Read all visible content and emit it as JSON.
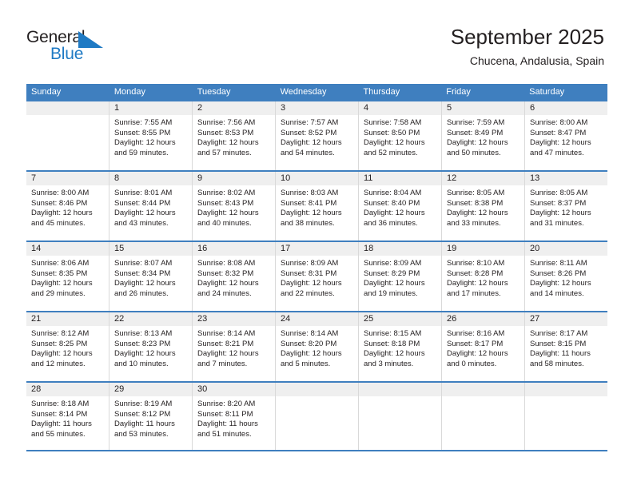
{
  "brand": {
    "name_top": "General",
    "name_bottom": "Blue",
    "triangle_icon": "triangle-icon",
    "color_dark": "#231f20",
    "color_blue": "#1f7ac4"
  },
  "header": {
    "title": "September 2025",
    "subtitle": "Chucena, Andalusia, Spain"
  },
  "calendar": {
    "accent_color": "#3f7fbf",
    "band_color": "#efefef",
    "weekday_headers": [
      "Sunday",
      "Monday",
      "Tuesday",
      "Wednesday",
      "Thursday",
      "Friday",
      "Saturday"
    ],
    "weeks": [
      [
        {
          "day": "",
          "lines": []
        },
        {
          "day": "1",
          "lines": [
            "Sunrise: 7:55 AM",
            "Sunset: 8:55 PM",
            "Daylight: 12 hours",
            "and 59 minutes."
          ]
        },
        {
          "day": "2",
          "lines": [
            "Sunrise: 7:56 AM",
            "Sunset: 8:53 PM",
            "Daylight: 12 hours",
            "and 57 minutes."
          ]
        },
        {
          "day": "3",
          "lines": [
            "Sunrise: 7:57 AM",
            "Sunset: 8:52 PM",
            "Daylight: 12 hours",
            "and 54 minutes."
          ]
        },
        {
          "day": "4",
          "lines": [
            "Sunrise: 7:58 AM",
            "Sunset: 8:50 PM",
            "Daylight: 12 hours",
            "and 52 minutes."
          ]
        },
        {
          "day": "5",
          "lines": [
            "Sunrise: 7:59 AM",
            "Sunset: 8:49 PM",
            "Daylight: 12 hours",
            "and 50 minutes."
          ]
        },
        {
          "day": "6",
          "lines": [
            "Sunrise: 8:00 AM",
            "Sunset: 8:47 PM",
            "Daylight: 12 hours",
            "and 47 minutes."
          ]
        }
      ],
      [
        {
          "day": "7",
          "lines": [
            "Sunrise: 8:00 AM",
            "Sunset: 8:46 PM",
            "Daylight: 12 hours",
            "and 45 minutes."
          ]
        },
        {
          "day": "8",
          "lines": [
            "Sunrise: 8:01 AM",
            "Sunset: 8:44 PM",
            "Daylight: 12 hours",
            "and 43 minutes."
          ]
        },
        {
          "day": "9",
          "lines": [
            "Sunrise: 8:02 AM",
            "Sunset: 8:43 PM",
            "Daylight: 12 hours",
            "and 40 minutes."
          ]
        },
        {
          "day": "10",
          "lines": [
            "Sunrise: 8:03 AM",
            "Sunset: 8:41 PM",
            "Daylight: 12 hours",
            "and 38 minutes."
          ]
        },
        {
          "day": "11",
          "lines": [
            "Sunrise: 8:04 AM",
            "Sunset: 8:40 PM",
            "Daylight: 12 hours",
            "and 36 minutes."
          ]
        },
        {
          "day": "12",
          "lines": [
            "Sunrise: 8:05 AM",
            "Sunset: 8:38 PM",
            "Daylight: 12 hours",
            "and 33 minutes."
          ]
        },
        {
          "day": "13",
          "lines": [
            "Sunrise: 8:05 AM",
            "Sunset: 8:37 PM",
            "Daylight: 12 hours",
            "and 31 minutes."
          ]
        }
      ],
      [
        {
          "day": "14",
          "lines": [
            "Sunrise: 8:06 AM",
            "Sunset: 8:35 PM",
            "Daylight: 12 hours",
            "and 29 minutes."
          ]
        },
        {
          "day": "15",
          "lines": [
            "Sunrise: 8:07 AM",
            "Sunset: 8:34 PM",
            "Daylight: 12 hours",
            "and 26 minutes."
          ]
        },
        {
          "day": "16",
          "lines": [
            "Sunrise: 8:08 AM",
            "Sunset: 8:32 PM",
            "Daylight: 12 hours",
            "and 24 minutes."
          ]
        },
        {
          "day": "17",
          "lines": [
            "Sunrise: 8:09 AM",
            "Sunset: 8:31 PM",
            "Daylight: 12 hours",
            "and 22 minutes."
          ]
        },
        {
          "day": "18",
          "lines": [
            "Sunrise: 8:09 AM",
            "Sunset: 8:29 PM",
            "Daylight: 12 hours",
            "and 19 minutes."
          ]
        },
        {
          "day": "19",
          "lines": [
            "Sunrise: 8:10 AM",
            "Sunset: 8:28 PM",
            "Daylight: 12 hours",
            "and 17 minutes."
          ]
        },
        {
          "day": "20",
          "lines": [
            "Sunrise: 8:11 AM",
            "Sunset: 8:26 PM",
            "Daylight: 12 hours",
            "and 14 minutes."
          ]
        }
      ],
      [
        {
          "day": "21",
          "lines": [
            "Sunrise: 8:12 AM",
            "Sunset: 8:25 PM",
            "Daylight: 12 hours",
            "and 12 minutes."
          ]
        },
        {
          "day": "22",
          "lines": [
            "Sunrise: 8:13 AM",
            "Sunset: 8:23 PM",
            "Daylight: 12 hours",
            "and 10 minutes."
          ]
        },
        {
          "day": "23",
          "lines": [
            "Sunrise: 8:14 AM",
            "Sunset: 8:21 PM",
            "Daylight: 12 hours",
            "and 7 minutes."
          ]
        },
        {
          "day": "24",
          "lines": [
            "Sunrise: 8:14 AM",
            "Sunset: 8:20 PM",
            "Daylight: 12 hours",
            "and 5 minutes."
          ]
        },
        {
          "day": "25",
          "lines": [
            "Sunrise: 8:15 AM",
            "Sunset: 8:18 PM",
            "Daylight: 12 hours",
            "and 3 minutes."
          ]
        },
        {
          "day": "26",
          "lines": [
            "Sunrise: 8:16 AM",
            "Sunset: 8:17 PM",
            "Daylight: 12 hours",
            "and 0 minutes."
          ]
        },
        {
          "day": "27",
          "lines": [
            "Sunrise: 8:17 AM",
            "Sunset: 8:15 PM",
            "Daylight: 11 hours",
            "and 58 minutes."
          ]
        }
      ],
      [
        {
          "day": "28",
          "lines": [
            "Sunrise: 8:18 AM",
            "Sunset: 8:14 PM",
            "Daylight: 11 hours",
            "and 55 minutes."
          ]
        },
        {
          "day": "29",
          "lines": [
            "Sunrise: 8:19 AM",
            "Sunset: 8:12 PM",
            "Daylight: 11 hours",
            "and 53 minutes."
          ]
        },
        {
          "day": "30",
          "lines": [
            "Sunrise: 8:20 AM",
            "Sunset: 8:11 PM",
            "Daylight: 11 hours",
            "and 51 minutes."
          ]
        },
        {
          "day": "",
          "lines": []
        },
        {
          "day": "",
          "lines": []
        },
        {
          "day": "",
          "lines": []
        },
        {
          "day": "",
          "lines": []
        }
      ]
    ]
  }
}
